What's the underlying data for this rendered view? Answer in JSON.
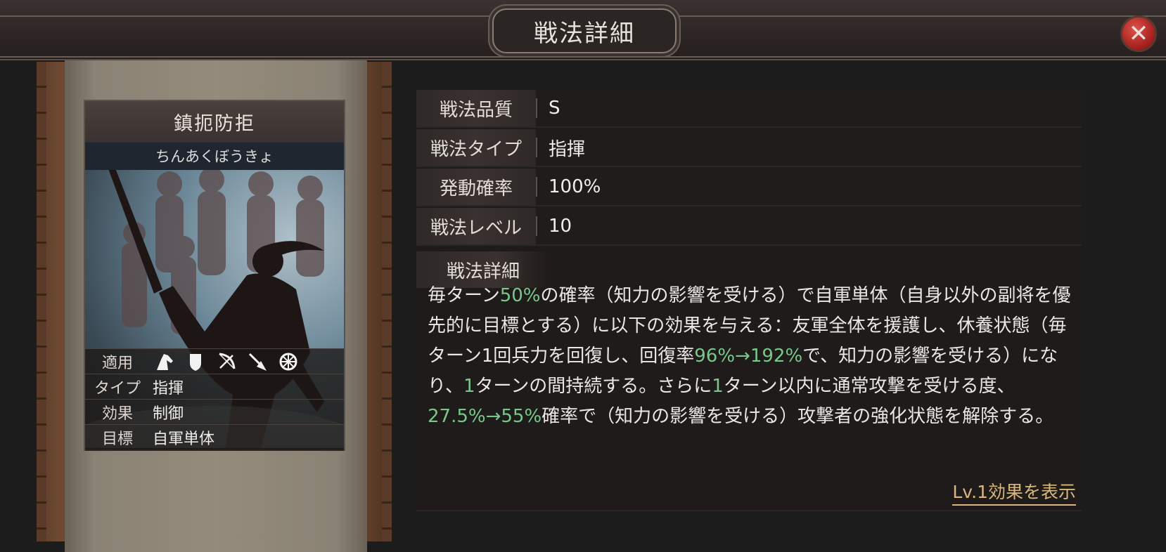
{
  "header": {
    "title": "戦法詳細",
    "close_icon": "close-icon"
  },
  "card": {
    "name": "鎮扼防拒",
    "reading": "ちんあくぼうきょ",
    "attributes": [
      {
        "key": "適用",
        "icons": [
          "cavalry-icon",
          "shield-icon",
          "bow-icon",
          "spear-icon",
          "wheel-icon"
        ]
      },
      {
        "key": "タイプ",
        "value": "指揮"
      },
      {
        "key": "効果",
        "value": "制御"
      },
      {
        "key": "目標",
        "value": "自軍単体"
      }
    ]
  },
  "info": [
    {
      "key": "戦法品質",
      "value": "S"
    },
    {
      "key": "戦法タイプ",
      "value": "指揮"
    },
    {
      "key": "発動確率",
      "value": "100%"
    },
    {
      "key": "戦法レベル",
      "value": "10"
    }
  ],
  "detail": {
    "label": "戦法詳細",
    "segments": [
      {
        "text": "毎ターン",
        "highlight": false
      },
      {
        "text": "50%",
        "highlight": true
      },
      {
        "text": "の確率（知力の影響を受ける）で自軍単体（自身以外の副将を優先的に目標とする）に以下の効果を与える：友軍全体を援護し、休養状態（毎ターン1回兵力を回復し、回復率",
        "highlight": false
      },
      {
        "text": "96%→192%",
        "highlight": true
      },
      {
        "text": "で、知力の影響を受ける）になり、",
        "highlight": false
      },
      {
        "text": "1",
        "highlight": true
      },
      {
        "text": "ターンの間持続する。さらに",
        "highlight": false
      },
      {
        "text": "1",
        "highlight": true
      },
      {
        "text": "ターン以内に通常攻撃を受ける度、",
        "highlight": false
      },
      {
        "text": "27.5%→55%",
        "highlight": true
      },
      {
        "text": "確率で（知力の影響を受ける）攻撃者の強化状態を解除する。",
        "highlight": false
      }
    ],
    "link": "Lv.1効果を表示"
  },
  "colors": {
    "highlight": "#78c88a",
    "link": "#d8b77c",
    "close": "#c0302a"
  }
}
